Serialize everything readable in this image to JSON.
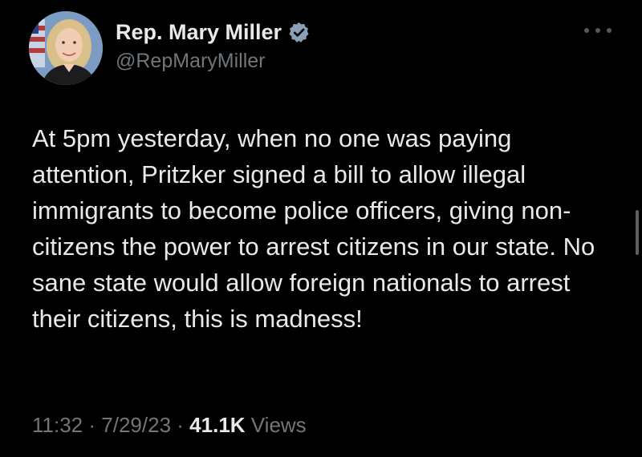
{
  "author": {
    "display_name": "Rep. Mary Miller",
    "handle": "@RepMaryMiller",
    "verified_badge": "verified-icon",
    "verified_color": "#8aa0b6"
  },
  "tweet": {
    "text": "At 5pm yesterday, when no one was paying attention, Pritzker signed a bill to allow illegal immigrants to become police officers, giving non-citizens the power to arrest citizens in our state. No sane state would allow foreign nationals to arrest their citizens, this is madness!"
  },
  "meta": {
    "time": "11:32",
    "date": "7/29/23",
    "separator": "·",
    "views_count": "41.1K",
    "views_label": "Views"
  },
  "menu": {
    "icon": "more-icon"
  },
  "theme": {
    "background": "#000000",
    "text": "#e7e9ea",
    "muted": "#71767b"
  }
}
